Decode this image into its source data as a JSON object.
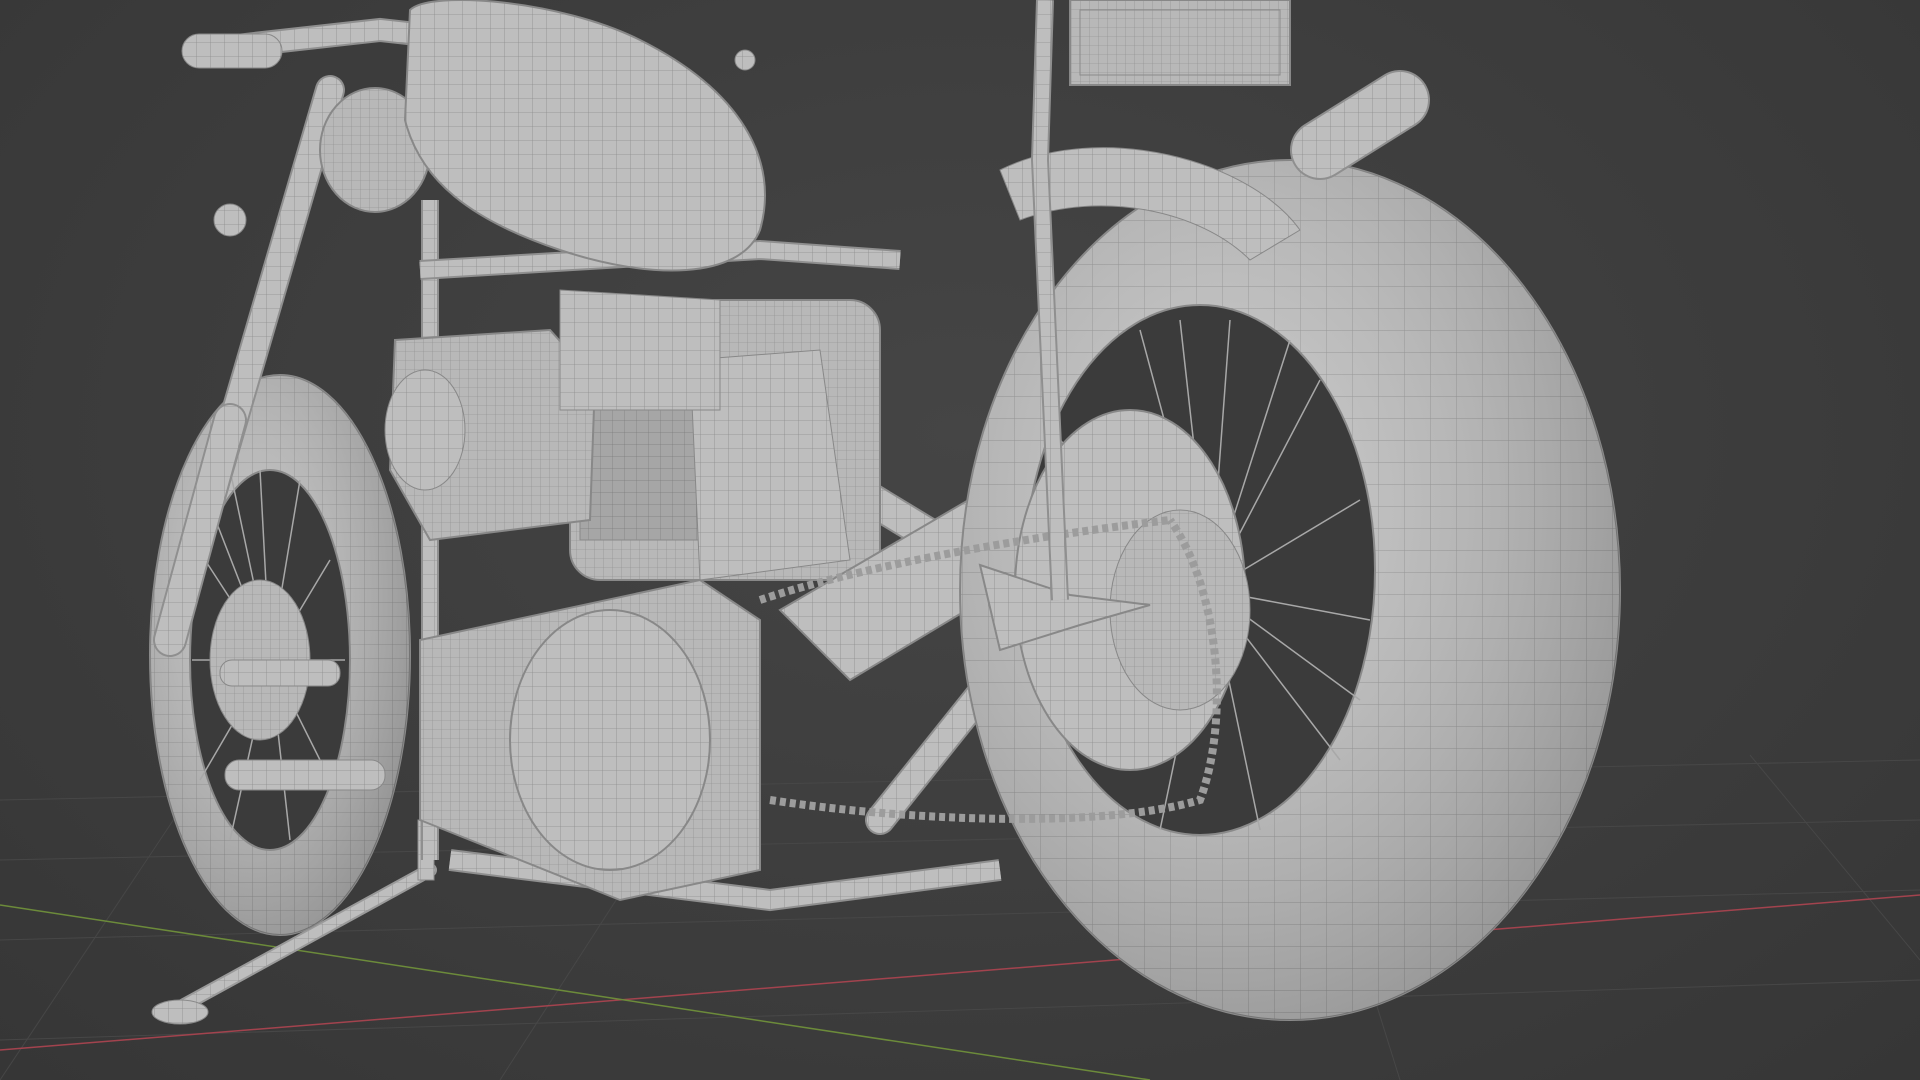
{
  "viewport": {
    "background_color": "#3d3d3d",
    "grid_color": "#4a4a4a",
    "x_axis_color": "#a3434e",
    "y_axis_color": "#6c8b3a"
  },
  "model": {
    "name": "motorcycle-mesh",
    "display_mode": "solid-wireframe",
    "surface_color": "#bdbdbd",
    "wire_color": "#8a8a8a",
    "parts": [
      "rear-tire",
      "front-tire",
      "fuel-tank",
      "engine",
      "chain",
      "frame",
      "exhaust",
      "kickstand",
      "handlebar",
      "license-plate"
    ]
  }
}
